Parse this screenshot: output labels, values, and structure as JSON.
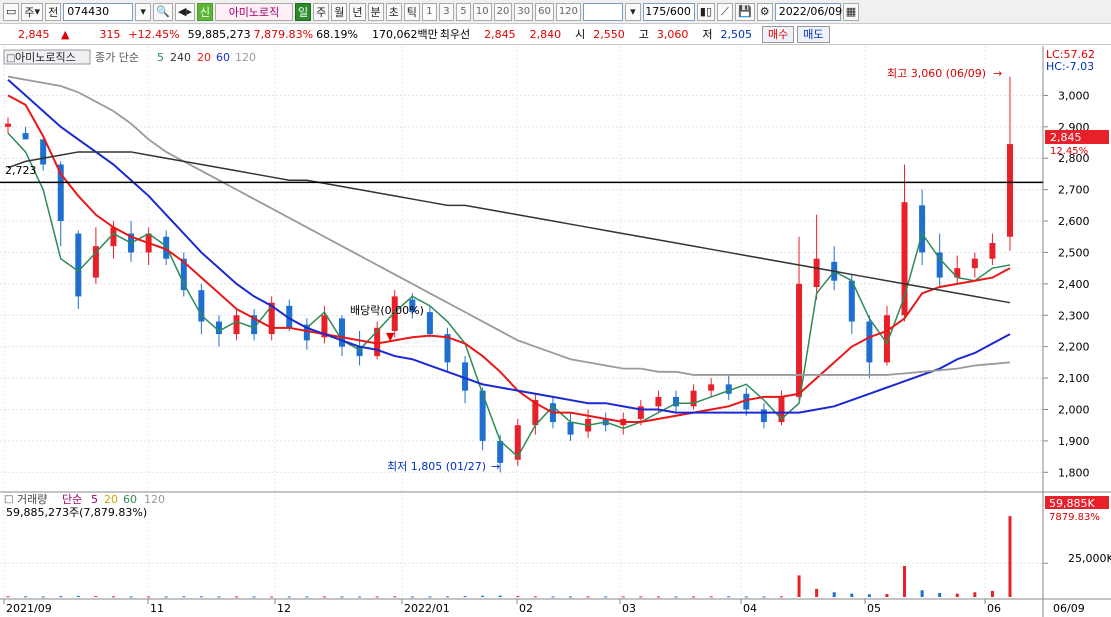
{
  "toolbar": {
    "market": "주",
    "period_sel": "전",
    "code": "074430",
    "name": "아미노로직",
    "badge": "신",
    "periods": [
      "일",
      "주",
      "월",
      "년",
      "분",
      "초",
      "틱"
    ],
    "minutes": [
      "1",
      "3",
      "5",
      "10",
      "20",
      "30",
      "60",
      "120"
    ],
    "count": "175/600",
    "date": "2022/06/09"
  },
  "quote": {
    "price": "2,845",
    "arrow": "▲",
    "change": "315",
    "pct": "+12.45%",
    "volume": "59,885,273",
    "vol_pct": "7,879.83%",
    "rate": "68.19%",
    "amount": "170,062백만",
    "best_label": "최우선",
    "best_ask": "2,845",
    "best_bid": "2,840",
    "open_label": "시",
    "open": "2,550",
    "high_label": "고",
    "high": "3,060",
    "low_label": "저",
    "low": "2,505",
    "buy": "매수",
    "sell": "매도"
  },
  "price_panel": {
    "legend": {
      "name": "아미노로직스",
      "type": "종가 단순",
      "ma": [
        "5",
        "240",
        "20",
        "60",
        "120"
      ]
    },
    "lc": "LC:57.62",
    "hc": "HC:-7.03",
    "current": "2,845",
    "current_pct": "12.45%",
    "level_label": "2,723",
    "max_note": "최고 3,060 (06/09)",
    "min_note": "최저 1,805 (01/27)",
    "dividend_note": "배당락(0.00%)",
    "yticks": [
      "3,000",
      "2,900",
      "2,800",
      "2,700",
      "2,600",
      "2,500",
      "2,400",
      "2,300",
      "2,200",
      "2,100",
      "2,000",
      "1,900",
      "1,800"
    ]
  },
  "volume_panel": {
    "legend": {
      "name": "거래량",
      "type": "단순",
      "ma": [
        "5",
        "20",
        "60",
        "120"
      ]
    },
    "value": "59,885,273주(7,879.83%)",
    "current": "59,885K",
    "current_pct": "7879.83%",
    "ytick": "25,000K"
  },
  "xaxis": [
    "2021/09",
    "11",
    "12",
    "2022/01",
    "02",
    "03",
    "04",
    "05",
    "06",
    "06/09"
  ],
  "colors": {
    "up": "#e8202a",
    "down": "#1e6fd0",
    "ma5": "#2e8b57",
    "ma20": "#e81818",
    "ma60": "#1a2ad0",
    "ma120": "#9a9a9a",
    "ma240": "#333333"
  },
  "chart_data": {
    "type": "candlestick",
    "ylim": [
      1750,
      3100
    ],
    "level": 2723,
    "x": [
      "2021/09",
      "11",
      "12",
      "2022/01",
      "02",
      "03",
      "04",
      "05",
      "06"
    ],
    "series": [
      {
        "name": "5",
        "values": [
          2880,
          2820,
          2700,
          2480,
          2440,
          2500,
          2560,
          2530,
          2560,
          2520,
          2400,
          2300,
          2250,
          2280,
          2260,
          2330,
          2290,
          2260,
          2310,
          2220,
          2190,
          2250,
          2310,
          2360,
          2330,
          2280,
          2210,
          2050,
          1900,
          1850,
          1950,
          2010,
          1960,
          1950,
          1960,
          1940,
          1960,
          1990,
          2020,
          2020,
          2040,
          2060,
          2080,
          2030,
          1970,
          2020,
          2370,
          2440,
          2410,
          2290,
          2210,
          2360,
          2560,
          2480,
          2420,
          2410,
          2450,
          2460
        ]
      },
      {
        "name": "20",
        "values": [
          3000,
          2970,
          2870,
          2750,
          2680,
          2620,
          2580,
          2550,
          2530,
          2510,
          2470,
          2420,
          2370,
          2320,
          2290,
          2260,
          2260,
          2250,
          2240,
          2230,
          2220,
          2210,
          2220,
          2230,
          2235,
          2230,
          2210,
          2170,
          2120,
          2060,
          2020,
          1990,
          1990,
          1980,
          1970,
          1960,
          1960,
          1970,
          1980,
          1990,
          2000,
          2010,
          2030,
          2040,
          2040,
          2050,
          2100,
          2150,
          2200,
          2230,
          2250,
          2290,
          2370,
          2390,
          2400,
          2410,
          2420,
          2450
        ]
      },
      {
        "name": "60",
        "values": [
          3050,
          3000,
          2950,
          2900,
          2860,
          2820,
          2780,
          2730,
          2680,
          2620,
          2560,
          2500,
          2450,
          2400,
          2360,
          2330,
          2290,
          2260,
          2240,
          2220,
          2200,
          2190,
          2170,
          2160,
          2140,
          2120,
          2100,
          2080,
          2070,
          2060,
          2050,
          2040,
          2030,
          2020,
          2020,
          2010,
          2000,
          2000,
          1990,
          1990,
          1990,
          1990,
          1990,
          1990,
          1990,
          1990,
          2000,
          2010,
          2030,
          2050,
          2070,
          2090,
          2110,
          2130,
          2160,
          2180,
          2210,
          2240
        ]
      },
      {
        "name": "120",
        "values": [
          3060,
          3050,
          3040,
          3030,
          3010,
          2980,
          2950,
          2910,
          2860,
          2820,
          2790,
          2760,
          2730,
          2700,
          2670,
          2640,
          2610,
          2580,
          2550,
          2520,
          2490,
          2460,
          2430,
          2400,
          2370,
          2340,
          2310,
          2280,
          2250,
          2220,
          2200,
          2180,
          2160,
          2150,
          2140,
          2130,
          2130,
          2120,
          2120,
          2110,
          2110,
          2110,
          2110,
          2110,
          2110,
          2110,
          2110,
          2110,
          2110,
          2110,
          2110,
          2115,
          2120,
          2125,
          2130,
          2140,
          2145,
          2150
        ]
      },
      {
        "name": "240",
        "values": [
          2770,
          2790,
          2800,
          2810,
          2820,
          2820,
          2820,
          2820,
          2810,
          2800,
          2790,
          2780,
          2770,
          2760,
          2750,
          2740,
          2730,
          2730,
          2720,
          2710,
          2700,
          2690,
          2680,
          2670,
          2660,
          2650,
          2650,
          2640,
          2630,
          2620,
          2610,
          2600,
          2590,
          2580,
          2570,
          2560,
          2550,
          2540,
          2530,
          2520,
          2510,
          2500,
          2490,
          2480,
          2470,
          2460,
          2450,
          2440,
          2430,
          2420,
          2410,
          2400,
          2390,
          2380,
          2370,
          2360,
          2350,
          2340
        ]
      }
    ],
    "candles": [
      [
        2900,
        2910,
        2880,
        2930
      ],
      [
        2880,
        2860,
        2860,
        2900
      ],
      [
        2860,
        2780,
        2760,
        2860
      ],
      [
        2780,
        2600,
        2520,
        2790
      ],
      [
        2560,
        2360,
        2320,
        2570
      ],
      [
        2420,
        2520,
        2400,
        2580
      ],
      [
        2520,
        2580,
        2480,
        2600
      ],
      [
        2560,
        2500,
        2470,
        2600
      ],
      [
        2500,
        2560,
        2460,
        2580
      ],
      [
        2550,
        2480,
        2460,
        2570
      ],
      [
        2480,
        2380,
        2360,
        2500
      ],
      [
        2380,
        2280,
        2240,
        2400
      ],
      [
        2280,
        2240,
        2200,
        2300
      ],
      [
        2240,
        2300,
        2220,
        2320
      ],
      [
        2300,
        2240,
        2220,
        2320
      ],
      [
        2240,
        2340,
        2220,
        2360
      ],
      [
        2330,
        2260,
        2250,
        2350
      ],
      [
        2270,
        2220,
        2190,
        2290
      ],
      [
        2230,
        2300,
        2210,
        2330
      ],
      [
        2290,
        2200,
        2170,
        2300
      ],
      [
        2200,
        2170,
        2140,
        2250
      ],
      [
        2170,
        2260,
        2160,
        2280
      ],
      [
        2250,
        2360,
        2230,
        2380
      ],
      [
        2350,
        2310,
        2290,
        2370
      ],
      [
        2310,
        2240,
        2230,
        2330
      ],
      [
        2240,
        2150,
        2120,
        2260
      ],
      [
        2150,
        2060,
        2020,
        2170
      ],
      [
        2060,
        1900,
        1870,
        2070
      ],
      [
        1900,
        1830,
        1800,
        1920
      ],
      [
        1840,
        1950,
        1820,
        1970
      ],
      [
        1950,
        2030,
        1920,
        2050
      ],
      [
        2020,
        1960,
        1940,
        2040
      ],
      [
        1960,
        1920,
        1900,
        1990
      ],
      [
        1930,
        1970,
        1910,
        2000
      ],
      [
        1970,
        1950,
        1930,
        1990
      ],
      [
        1950,
        1970,
        1920,
        1990
      ],
      [
        1970,
        2010,
        1950,
        2030
      ],
      [
        2010,
        2040,
        1990,
        2060
      ],
      [
        2040,
        2010,
        1990,
        2060
      ],
      [
        2010,
        2060,
        2000,
        2080
      ],
      [
        2060,
        2080,
        2040,
        2100
      ],
      [
        2080,
        2050,
        2030,
        2110
      ],
      [
        2050,
        2000,
        1980,
        2070
      ],
      [
        2000,
        1960,
        1940,
        2020
      ],
      [
        1960,
        2040,
        1950,
        2060
      ],
      [
        2040,
        2400,
        2030,
        2550
      ],
      [
        2390,
        2480,
        2350,
        2620
      ],
      [
        2470,
        2410,
        2380,
        2520
      ],
      [
        2410,
        2280,
        2240,
        2430
      ],
      [
        2280,
        2150,
        2100,
        2300
      ],
      [
        2150,
        2300,
        2140,
        2330
      ],
      [
        2300,
        2660,
        2280,
        2780
      ],
      [
        2650,
        2500,
        2460,
        2700
      ],
      [
        2500,
        2420,
        2390,
        2560
      ],
      [
        2420,
        2450,
        2400,
        2490
      ],
      [
        2450,
        2480,
        2420,
        2500
      ],
      [
        2480,
        2530,
        2460,
        2560
      ],
      [
        2550,
        2845,
        2505,
        3060
      ]
    ],
    "volume": {
      "ylim": [
        0,
        60000
      ],
      "ytick": 25000,
      "values": [
        500,
        500,
        400,
        600,
        800,
        700,
        500,
        400,
        400,
        400,
        500,
        500,
        400,
        400,
        400,
        400,
        400,
        400,
        400,
        400,
        400,
        400,
        500,
        400,
        400,
        500,
        600,
        900,
        1000,
        700,
        500,
        400,
        400,
        400,
        400,
        400,
        400,
        400,
        400,
        400,
        500,
        500,
        400,
        400,
        500,
        16000,
        6000,
        3500,
        2500,
        2000,
        2200,
        23000,
        5000,
        3000,
        2500,
        3500,
        4500,
        59885
      ]
    }
  }
}
